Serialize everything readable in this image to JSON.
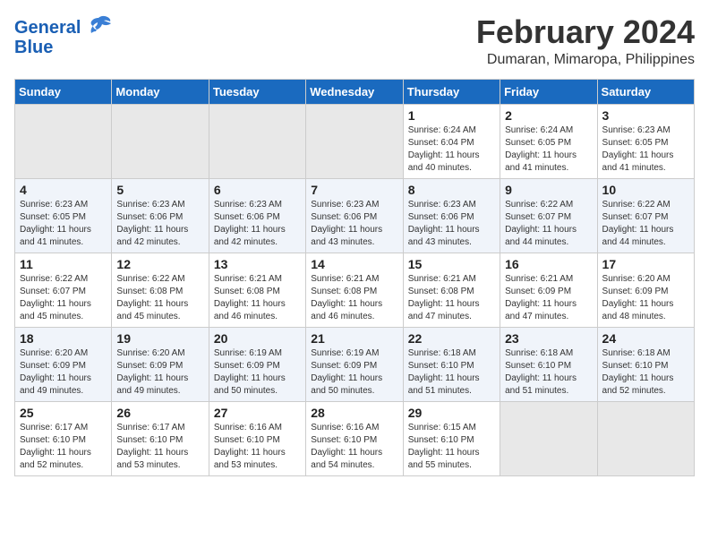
{
  "header": {
    "logo_line1": "General",
    "logo_line2": "Blue",
    "month_title": "February 2024",
    "location": "Dumaran, Mimaropa, Philippines"
  },
  "weekdays": [
    "Sunday",
    "Monday",
    "Tuesday",
    "Wednesday",
    "Thursday",
    "Friday",
    "Saturday"
  ],
  "weeks": [
    [
      {
        "day": "",
        "info": ""
      },
      {
        "day": "",
        "info": ""
      },
      {
        "day": "",
        "info": ""
      },
      {
        "day": "",
        "info": ""
      },
      {
        "day": "1",
        "info": "Sunrise: 6:24 AM\nSunset: 6:04 PM\nDaylight: 11 hours\nand 40 minutes."
      },
      {
        "day": "2",
        "info": "Sunrise: 6:24 AM\nSunset: 6:05 PM\nDaylight: 11 hours\nand 41 minutes."
      },
      {
        "day": "3",
        "info": "Sunrise: 6:23 AM\nSunset: 6:05 PM\nDaylight: 11 hours\nand 41 minutes."
      }
    ],
    [
      {
        "day": "4",
        "info": "Sunrise: 6:23 AM\nSunset: 6:05 PM\nDaylight: 11 hours\nand 41 minutes."
      },
      {
        "day": "5",
        "info": "Sunrise: 6:23 AM\nSunset: 6:06 PM\nDaylight: 11 hours\nand 42 minutes."
      },
      {
        "day": "6",
        "info": "Sunrise: 6:23 AM\nSunset: 6:06 PM\nDaylight: 11 hours\nand 42 minutes."
      },
      {
        "day": "7",
        "info": "Sunrise: 6:23 AM\nSunset: 6:06 PM\nDaylight: 11 hours\nand 43 minutes."
      },
      {
        "day": "8",
        "info": "Sunrise: 6:23 AM\nSunset: 6:06 PM\nDaylight: 11 hours\nand 43 minutes."
      },
      {
        "day": "9",
        "info": "Sunrise: 6:22 AM\nSunset: 6:07 PM\nDaylight: 11 hours\nand 44 minutes."
      },
      {
        "day": "10",
        "info": "Sunrise: 6:22 AM\nSunset: 6:07 PM\nDaylight: 11 hours\nand 44 minutes."
      }
    ],
    [
      {
        "day": "11",
        "info": "Sunrise: 6:22 AM\nSunset: 6:07 PM\nDaylight: 11 hours\nand 45 minutes."
      },
      {
        "day": "12",
        "info": "Sunrise: 6:22 AM\nSunset: 6:08 PM\nDaylight: 11 hours\nand 45 minutes."
      },
      {
        "day": "13",
        "info": "Sunrise: 6:21 AM\nSunset: 6:08 PM\nDaylight: 11 hours\nand 46 minutes."
      },
      {
        "day": "14",
        "info": "Sunrise: 6:21 AM\nSunset: 6:08 PM\nDaylight: 11 hours\nand 46 minutes."
      },
      {
        "day": "15",
        "info": "Sunrise: 6:21 AM\nSunset: 6:08 PM\nDaylight: 11 hours\nand 47 minutes."
      },
      {
        "day": "16",
        "info": "Sunrise: 6:21 AM\nSunset: 6:09 PM\nDaylight: 11 hours\nand 47 minutes."
      },
      {
        "day": "17",
        "info": "Sunrise: 6:20 AM\nSunset: 6:09 PM\nDaylight: 11 hours\nand 48 minutes."
      }
    ],
    [
      {
        "day": "18",
        "info": "Sunrise: 6:20 AM\nSunset: 6:09 PM\nDaylight: 11 hours\nand 49 minutes."
      },
      {
        "day": "19",
        "info": "Sunrise: 6:20 AM\nSunset: 6:09 PM\nDaylight: 11 hours\nand 49 minutes."
      },
      {
        "day": "20",
        "info": "Sunrise: 6:19 AM\nSunset: 6:09 PM\nDaylight: 11 hours\nand 50 minutes."
      },
      {
        "day": "21",
        "info": "Sunrise: 6:19 AM\nSunset: 6:09 PM\nDaylight: 11 hours\nand 50 minutes."
      },
      {
        "day": "22",
        "info": "Sunrise: 6:18 AM\nSunset: 6:10 PM\nDaylight: 11 hours\nand 51 minutes."
      },
      {
        "day": "23",
        "info": "Sunrise: 6:18 AM\nSunset: 6:10 PM\nDaylight: 11 hours\nand 51 minutes."
      },
      {
        "day": "24",
        "info": "Sunrise: 6:18 AM\nSunset: 6:10 PM\nDaylight: 11 hours\nand 52 minutes."
      }
    ],
    [
      {
        "day": "25",
        "info": "Sunrise: 6:17 AM\nSunset: 6:10 PM\nDaylight: 11 hours\nand 52 minutes."
      },
      {
        "day": "26",
        "info": "Sunrise: 6:17 AM\nSunset: 6:10 PM\nDaylight: 11 hours\nand 53 minutes."
      },
      {
        "day": "27",
        "info": "Sunrise: 6:16 AM\nSunset: 6:10 PM\nDaylight: 11 hours\nand 53 minutes."
      },
      {
        "day": "28",
        "info": "Sunrise: 6:16 AM\nSunset: 6:10 PM\nDaylight: 11 hours\nand 54 minutes."
      },
      {
        "day": "29",
        "info": "Sunrise: 6:15 AM\nSunset: 6:10 PM\nDaylight: 11 hours\nand 55 minutes."
      },
      {
        "day": "",
        "info": ""
      },
      {
        "day": "",
        "info": ""
      }
    ]
  ]
}
